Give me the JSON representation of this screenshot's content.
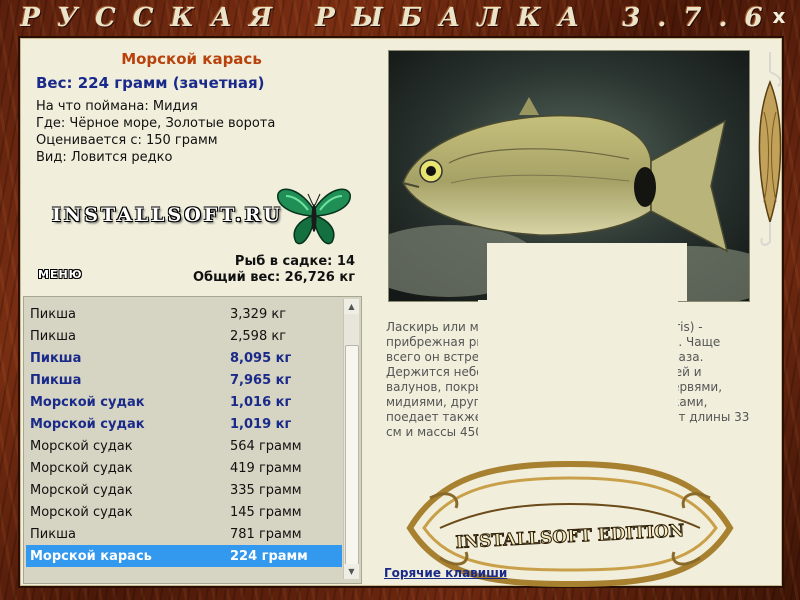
{
  "window": {
    "title": "РУССКАЯ РЫБАЛКА 3.7.6",
    "close": "x"
  },
  "fish": {
    "name": "Морской карась",
    "weight": "Вес: 224 грамм (зачетная)",
    "info": [
      "На что поймана: Мидия",
      "Где: Чёрное море, Золотые ворота",
      "Оценивается с: 150 грамм",
      "Вид: Ловится редко"
    ]
  },
  "logo": "INSTALLSOFT.RU",
  "menu_label": "МЕНЮ",
  "keep": {
    "count": "Рыб в садке: 14",
    "total": "Общий вес: 26,726 кг"
  },
  "catch_list": [
    {
      "name": "Пикша",
      "weight": "3,329 кг",
      "style": "normal"
    },
    {
      "name": "Пикша",
      "weight": "2,598 кг",
      "style": "normal"
    },
    {
      "name": "Пикша",
      "weight": "8,095 кг",
      "style": "bold"
    },
    {
      "name": "Пикша",
      "weight": "7,965 кг",
      "style": "bold"
    },
    {
      "name": "Морской судак",
      "weight": "1,016 кг",
      "style": "bold"
    },
    {
      "name": "Морской судак",
      "weight": "1,019 кг",
      "style": "bold"
    },
    {
      "name": "Морской судак",
      "weight": "564 грамм",
      "style": "normal"
    },
    {
      "name": "Морской судак",
      "weight": "419 грамм",
      "style": "normal"
    },
    {
      "name": "Морской судак",
      "weight": "335 грамм",
      "style": "normal"
    },
    {
      "name": "Морской судак",
      "weight": "145 грамм",
      "style": "normal"
    },
    {
      "name": "Пикша",
      "weight": "781 грамм",
      "style": "normal"
    },
    {
      "name": "Морской карась",
      "weight": "224 грамм",
      "style": "selected"
    }
  ],
  "description": "Ласкирь или морской карась (Diplodus annularis) - прибрежная рыба, обитающая в Чёрном море. Чаще всего он встречается у берегов Крыма и Кавказа. Держится небольшими стайками среди камней и валунов, покрытых водорослями, питается червями, мидиями, другими ракообразными и моллюсками, поедает также растительный корм. Достигает длины 33 см и массы 450 г.",
  "edition_badge": "INSTALLSOFT EDITION",
  "hotkeys": "Горячие клавиши",
  "colors": {
    "panel": "#f1efdc",
    "title": "#b8410c",
    "accent": "#1a2a8a",
    "selected": "#3399ee"
  }
}
